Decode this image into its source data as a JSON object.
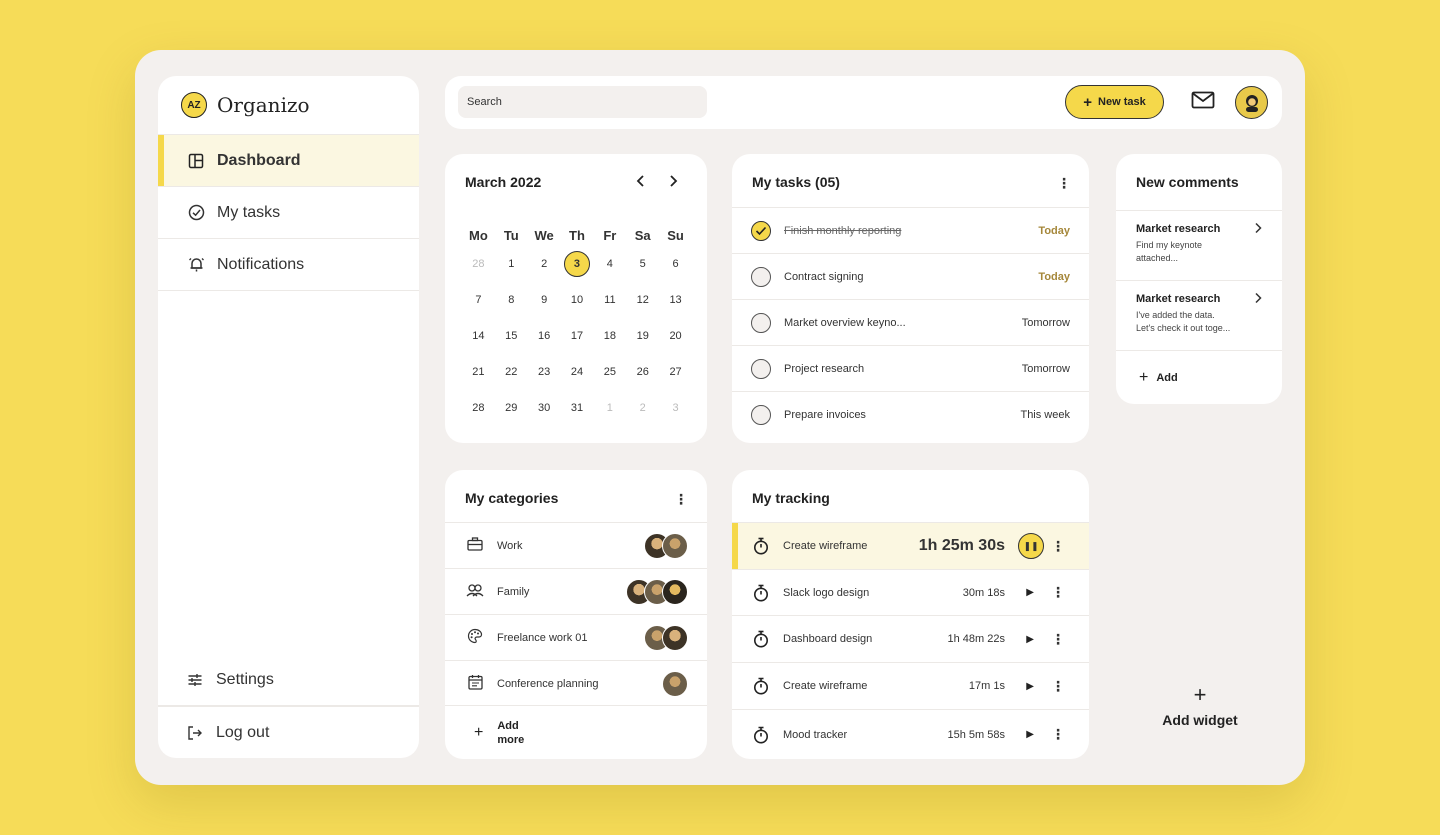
{
  "app": {
    "name": "Organizo",
    "logo_text": "AZ"
  },
  "sidebar": {
    "items": [
      {
        "label": "Dashboard",
        "icon": "layout-icon",
        "active": true
      },
      {
        "label": "My tasks",
        "icon": "check-circle-icon"
      },
      {
        "label": "Notifications",
        "icon": "bell-icon"
      }
    ],
    "bottom_items": [
      {
        "label": "Settings",
        "icon": "sliders-icon"
      },
      {
        "label": "Log out",
        "icon": "logout-icon"
      }
    ]
  },
  "topbar": {
    "search_placeholder": "Search",
    "new_task_label": "New task"
  },
  "calendar": {
    "title": "March 2022",
    "weekdays": [
      "Mo",
      "Tu",
      "We",
      "Th",
      "Fr",
      "Sa",
      "Su"
    ],
    "weeks": [
      [
        "28",
        "1",
        "2",
        "3",
        "4",
        "5",
        "6"
      ],
      [
        "7",
        "8",
        "9",
        "10",
        "11",
        "12",
        "13"
      ],
      [
        "14",
        "15",
        "16",
        "17",
        "18",
        "19",
        "20"
      ],
      [
        "21",
        "22",
        "23",
        "24",
        "25",
        "26",
        "27"
      ],
      [
        "28",
        "29",
        "30",
        "31",
        "1",
        "2",
        "3"
      ]
    ],
    "selected_day": "3"
  },
  "tasks": {
    "title": "My tasks (05)",
    "items": [
      {
        "label": "Finish monthly reporting",
        "due": "Today",
        "done": true
      },
      {
        "label": "Contract signing",
        "due": "Today",
        "done": false
      },
      {
        "label": "Market overview keyno...",
        "due": "Tomorrow",
        "done": false
      },
      {
        "label": "Project research",
        "due": "Tomorrow",
        "done": false
      },
      {
        "label": "Prepare invoices",
        "due": "This week",
        "done": false
      }
    ]
  },
  "comments": {
    "title": "New comments",
    "items": [
      {
        "title": "Market research",
        "lines": [
          "Find my keynote",
          "attached..."
        ]
      },
      {
        "title": "Market research",
        "lines": [
          "I've added the data.",
          "Let's check it out toge..."
        ]
      }
    ],
    "add_label": "Add"
  },
  "categories": {
    "title": "My categories",
    "items": [
      {
        "label": "Work",
        "icon": "briefcase-icon",
        "avatars": 2
      },
      {
        "label": "Family",
        "icon": "people-icon",
        "avatars": 3
      },
      {
        "label": "Freelance work 01",
        "icon": "palette-icon",
        "avatars": 2
      },
      {
        "label": "Conference planning",
        "icon": "calendar-icon",
        "avatars": 1
      }
    ],
    "add_label_1": "Add",
    "add_label_2": "more"
  },
  "tracking": {
    "title": "My tracking",
    "items": [
      {
        "label": "Create wireframe",
        "time": "1h 25m 30s",
        "active": true
      },
      {
        "label": "Slack logo design",
        "time": "30m 18s"
      },
      {
        "label": "Dashboard design",
        "time": "1h 48m 22s"
      },
      {
        "label": "Create wireframe",
        "time": "17m 1s"
      },
      {
        "label": "Mood tracker",
        "time": "15h 5m 58s"
      }
    ]
  },
  "add_widget_label": "Add widget"
}
